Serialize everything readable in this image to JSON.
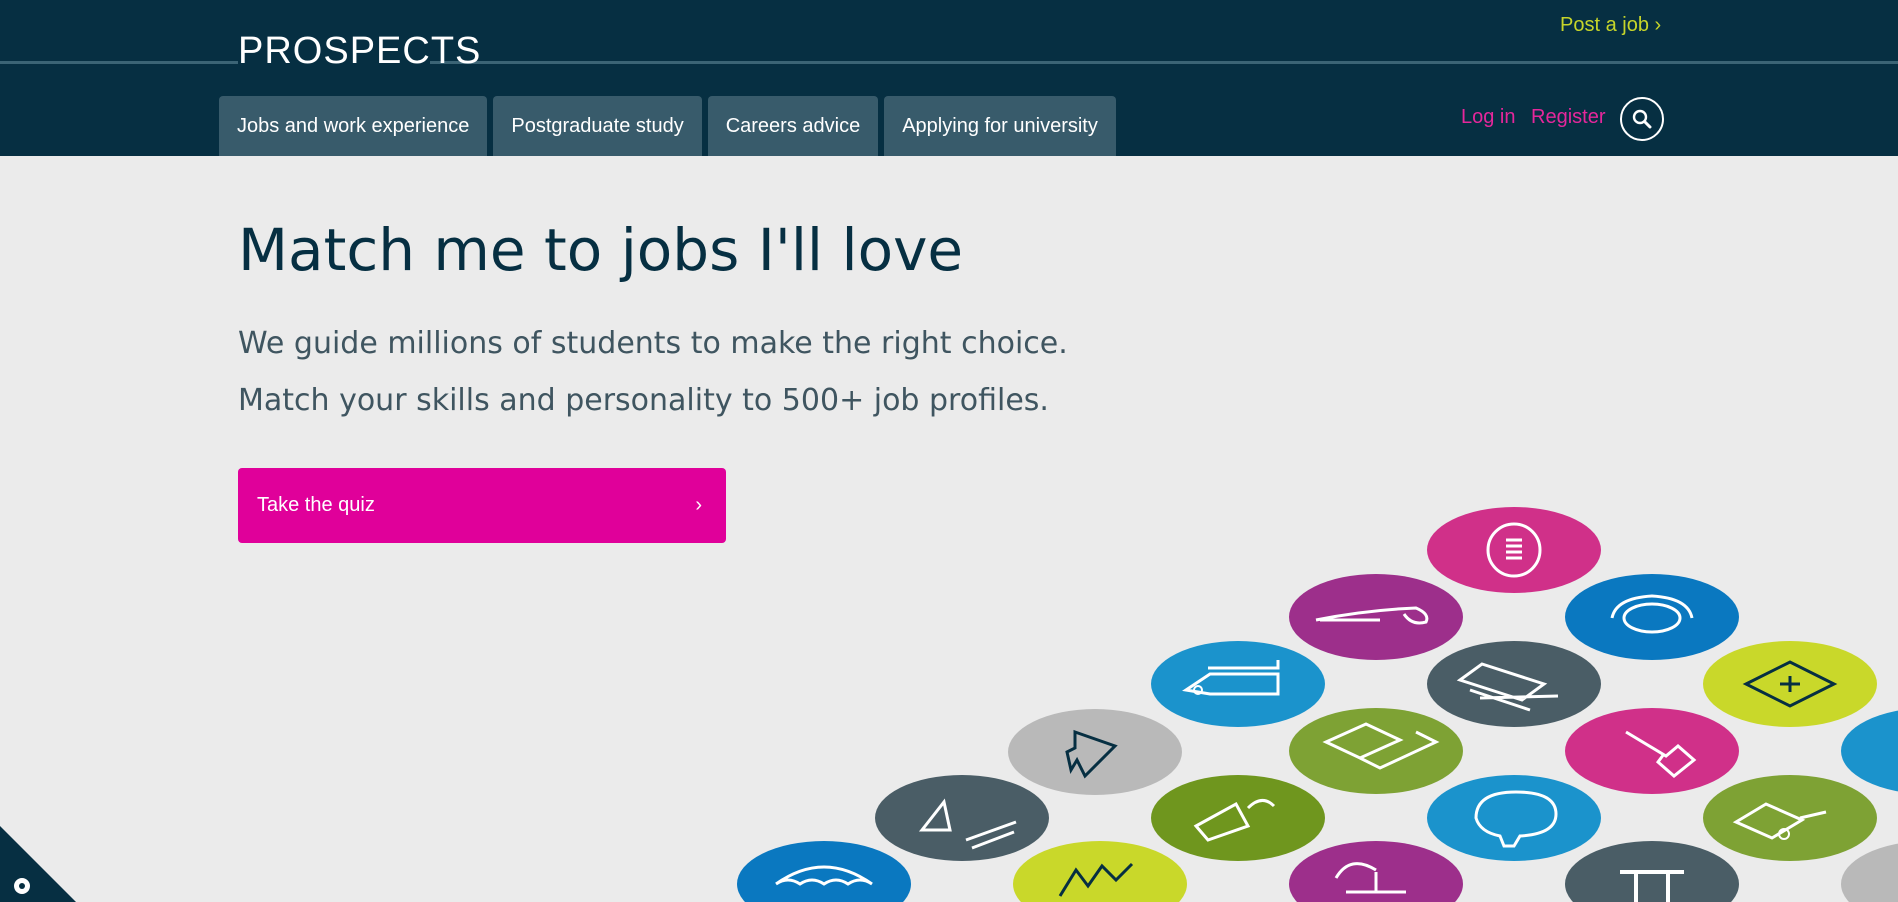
{
  "header": {
    "logo": "PROSPECTS",
    "post_job": "Post a job ›",
    "nav": [
      {
        "label": "Jobs and work experience"
      },
      {
        "label": "Postgraduate study"
      },
      {
        "label": "Careers advice"
      },
      {
        "label": "Applying for university"
      }
    ],
    "login": "Log in",
    "register": "Register",
    "search_icon": "search-icon"
  },
  "hero": {
    "title": "Match me to jobs I'll love",
    "line1": "We guide millions of students to make the right choice.",
    "line2": "Match your skills and personality to 500+ job profiles.",
    "cta_label": "Take the quiz",
    "cta_arrow": "›"
  },
  "colors": {
    "header_bg": "#062f42",
    "tab_bg": "#385b6b",
    "accent_pink": "#e0009a",
    "accent_lime": "#c6d52a",
    "page_bg": "#ebebeb"
  },
  "decor_icons": [
    "umbrella-icon",
    "triangle-icon",
    "bird-icon",
    "trees-icon",
    "megaphone-icon",
    "laptop-icon",
    "cake-icon",
    "tag-icon",
    "pen-icon",
    "document-icon",
    "piggy-bank-icon",
    "tool-icon",
    "camera-icon",
    "spatula-icon",
    "medical-icon",
    "truck-icon",
    "dollar-icon"
  ],
  "cookie_icon": "cookie-settings-icon"
}
